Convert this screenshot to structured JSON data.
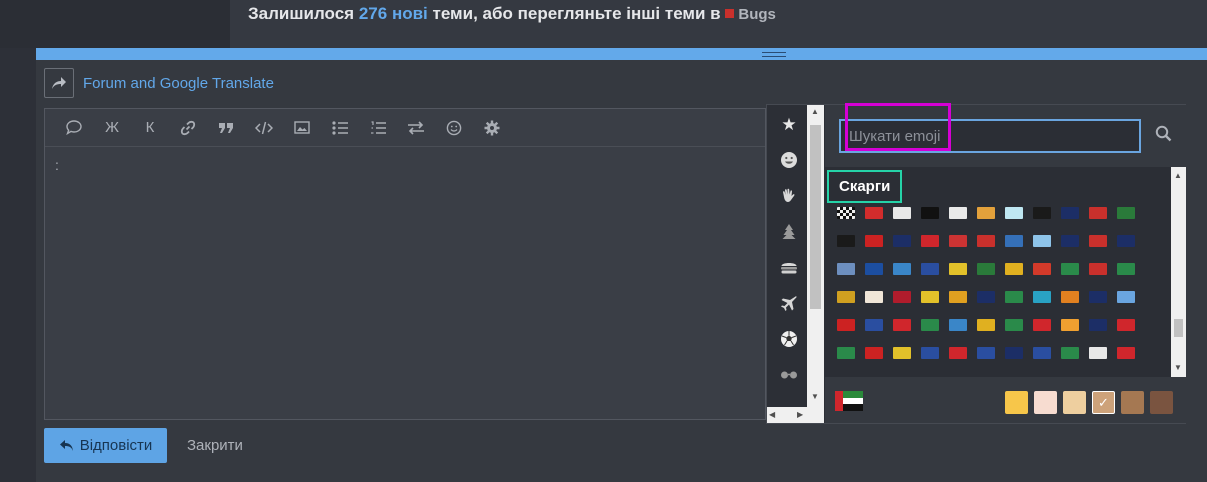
{
  "header": {
    "prefix": "Залишилося",
    "count": "276",
    "new_word": "нові",
    "middle": "теми, або перегляньте інші теми в",
    "forum": "Bugs"
  },
  "translate": {
    "label": "Forum and Google Translate"
  },
  "toolbar": {
    "buttons": [
      "speech-bubble",
      "Ж",
      "К",
      "link",
      "quote",
      "code",
      "image",
      "bullet-list",
      "numbered-list",
      "swap",
      "smiley",
      "gear"
    ],
    "bold_label": "Ж",
    "italic_label": "К"
  },
  "editor": {
    "content": ":"
  },
  "actions": {
    "reply_label": "Відповісти",
    "close_label": "Закрити"
  },
  "emoji": {
    "search_placeholder": "Шукати emoji",
    "section_title": "Скарги",
    "categories": [
      "star-icon",
      "smiley-face-icon",
      "waving-hand-icon",
      "tree-icon",
      "burger-icon",
      "airplane-icon",
      "soccer-ball-icon",
      "glasses-icon",
      "object-icon"
    ],
    "flag_rows": [
      [
        "#f2f2f2",
        "#d22c2c",
        "#e8e8e8",
        "#111111",
        "#e9e9e9",
        "#e3a13b",
        "#bfe7f2",
        "#1a1a1a",
        "#1c2e66",
        "#c9302c",
        "#2a7a3a"
      ],
      [
        "#1a1a1a",
        "#cc2222",
        "#1c2e66",
        "#d0262c",
        "#cc3333",
        "#c9302c",
        "#3570b8",
        "#8ec4ea",
        "#1c2e66",
        "#c9302c",
        "#1c2e66"
      ],
      [
        "#6d8fbf",
        "#1c4ea0",
        "#3a86c8",
        "#2a4ea0",
        "#e2c12a",
        "#2a7a3a",
        "#e0b020",
        "#d33a2a",
        "#2a8a4a",
        "#c9302c",
        "#2a8a4a"
      ],
      [
        "#d0a020",
        "#f0e6d8",
        "#b01c2c",
        "#e2c12a",
        "#e0a020",
        "#1c2e66",
        "#2a8a4a",
        "#29a2c4",
        "#e08020",
        "#1c2e66",
        "#6aa5e0"
      ],
      [
        "#cc2222",
        "#2a4ea0",
        "#d0262c",
        "#2a8a4a",
        "#3a86c8",
        "#e0b020",
        "#2a8a4a",
        "#d0262c",
        "#f0a030",
        "#1c2e66",
        "#d0262c"
      ],
      [
        "#2a8a4a",
        "#cc2222",
        "#e2c12a",
        "#2a4ea0",
        "#d0262c",
        "#2a4ea0",
        "#1c2e66",
        "#2a4ea0",
        "#2a8a4a",
        "#e8e8e8",
        "#d0262c"
      ]
    ],
    "skin_tones": [
      "#f7c64a",
      "#f7dcd0",
      "#eecf9f",
      "#cda27a",
      "#a57852",
      "#7a5440"
    ],
    "selected_tone_index": 3
  },
  "colors": {
    "accent": "#63a9ea",
    "magenta_highlight": "#d500d5",
    "teal_highlight": "#25d3a8"
  }
}
